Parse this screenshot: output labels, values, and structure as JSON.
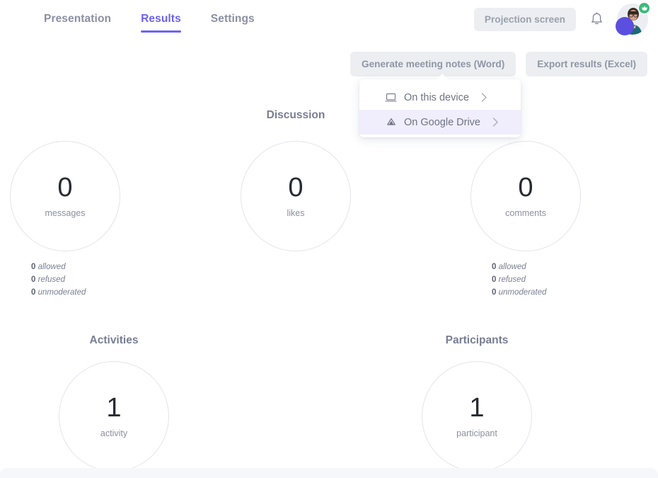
{
  "header": {
    "tabs": [
      {
        "label": "Presentation",
        "active": false
      },
      {
        "label": "Results",
        "active": true
      },
      {
        "label": "Settings",
        "active": false
      }
    ],
    "projection_button": "Projection screen",
    "bell_icon": "bell-icon",
    "avatar_badge_icon": "crown-badge-icon"
  },
  "actions": {
    "generate_notes": "Generate meeting notes (Word)",
    "export_results": "Export results (Excel)"
  },
  "dropdown": {
    "items": [
      {
        "label": "On this device",
        "icon": "laptop-icon",
        "highlighted": false
      },
      {
        "label": "On Google Drive",
        "icon": "google-drive-icon",
        "highlighted": true
      }
    ],
    "chevron_icon": "chevron-right-icon"
  },
  "sections": {
    "discussion": {
      "title": "Discussion",
      "stats": [
        {
          "value": "0",
          "label": "messages",
          "substats": [
            {
              "value": "0",
              "text": "allowed"
            },
            {
              "value": "0",
              "text": "refused"
            },
            {
              "value": "0",
              "text": "unmoderated"
            }
          ]
        },
        {
          "value": "0",
          "label": "likes",
          "substats": []
        },
        {
          "value": "0",
          "label": "comments",
          "substats": [
            {
              "value": "0",
              "text": "allowed"
            },
            {
              "value": "0",
              "text": "refused"
            },
            {
              "value": "0",
              "text": "unmoderated"
            }
          ]
        }
      ]
    },
    "activities": {
      "title": "Activities",
      "value": "1",
      "label": "activity"
    },
    "participants": {
      "title": "Participants",
      "value": "1",
      "label": "participant"
    }
  },
  "colors": {
    "accent": "#6c63f0",
    "button_bg": "#eceef1",
    "highlight_bg": "#f0edfc",
    "badge_green": "#3dba7d",
    "circle_border": "#e3e4ed"
  }
}
